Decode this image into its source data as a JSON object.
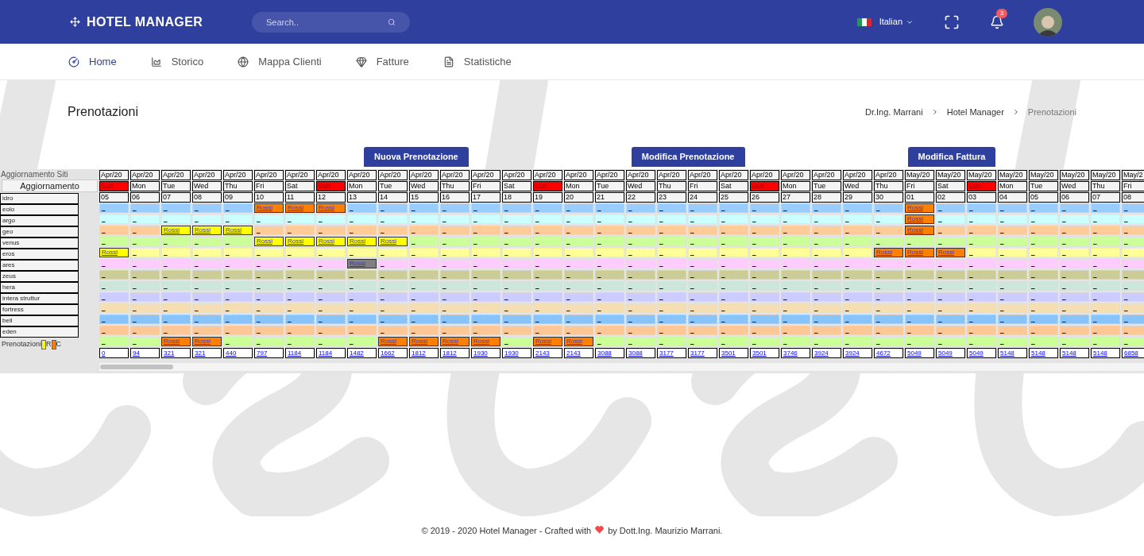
{
  "header": {
    "brand": "HOTEL MANAGER",
    "search": {
      "placeholder": "Search.."
    },
    "language": "Italian",
    "notifications": "3"
  },
  "nav": [
    {
      "label": "Home",
      "selected": true
    },
    {
      "label": "Storico",
      "selected": false
    },
    {
      "label": "Mappa Clienti",
      "selected": false
    },
    {
      "label": "Fatture",
      "selected": false
    },
    {
      "label": "Statistiche",
      "selected": false
    }
  ],
  "page_title": "Prenotazioni",
  "breadcrumb": [
    "Dr.Ing. Marrani",
    "Hotel Manager",
    "Prenotazioni"
  ],
  "actions": [
    "Nuova Prenotazione",
    "Modifica Prenotazione",
    "Modifica Fattura"
  ],
  "sidebar": {
    "title": "Aggiornamento Siti",
    "button": "Aggiornamento",
    "legend": {
      "label": "Prenotazioni",
      "items": [
        {
          "text": "R",
          "color": "#ffff00"
        },
        {
          "text": "C",
          "color": "#ff8000"
        }
      ]
    }
  },
  "columns": [
    {
      "month": "Apr/20",
      "weekday": "Sun",
      "day": "05",
      "holiday": true,
      "total": "0"
    },
    {
      "month": "Apr/20",
      "weekday": "Mon",
      "day": "06",
      "holiday": false,
      "total": "94"
    },
    {
      "month": "Apr/20",
      "weekday": "Tue",
      "day": "07",
      "holiday": false,
      "total": "321"
    },
    {
      "month": "Apr/20",
      "weekday": "Wed",
      "day": "08",
      "holiday": false,
      "total": "321"
    },
    {
      "month": "Apr/20",
      "weekday": "Thu",
      "day": "09",
      "holiday": false,
      "total": "440"
    },
    {
      "month": "Apr/20",
      "weekday": "Fri",
      "day": "10",
      "holiday": false,
      "total": "797"
    },
    {
      "month": "Apr/20",
      "weekday": "Sat",
      "day": "11",
      "holiday": false,
      "total": "1184"
    },
    {
      "month": "Apr/20",
      "weekday": "Sun",
      "day": "12",
      "holiday": true,
      "total": "1184"
    },
    {
      "month": "Apr/20",
      "weekday": "Mon",
      "day": "13",
      "holiday": false,
      "total": "1482"
    },
    {
      "month": "Apr/20",
      "weekday": "Tue",
      "day": "14",
      "holiday": false,
      "total": "1662"
    },
    {
      "month": "Apr/20",
      "weekday": "Wed",
      "day": "15",
      "holiday": false,
      "total": "1812"
    },
    {
      "month": "Apr/20",
      "weekday": "Thu",
      "day": "16",
      "holiday": false,
      "total": "1812"
    },
    {
      "month": "Apr/20",
      "weekday": "Fri",
      "day": "17",
      "holiday": false,
      "total": "1930"
    },
    {
      "month": "Apr/20",
      "weekday": "Sat",
      "day": "18",
      "holiday": false,
      "total": "1930"
    },
    {
      "month": "Apr/20",
      "weekday": "Sun",
      "day": "19",
      "holiday": true,
      "total": "2143"
    },
    {
      "month": "Apr/20",
      "weekday": "Mon",
      "day": "20",
      "holiday": false,
      "total": "2143"
    },
    {
      "month": "Apr/20",
      "weekday": "Tue",
      "day": "21",
      "holiday": false,
      "total": "3088"
    },
    {
      "month": "Apr/20",
      "weekday": "Wed",
      "day": "22",
      "holiday": false,
      "total": "3088"
    },
    {
      "month": "Apr/20",
      "weekday": "Thu",
      "day": "23",
      "holiday": false,
      "total": "3177"
    },
    {
      "month": "Apr/20",
      "weekday": "Fri",
      "day": "24",
      "holiday": false,
      "total": "3177"
    },
    {
      "month": "Apr/20",
      "weekday": "Sat",
      "day": "25",
      "holiday": false,
      "total": "3501"
    },
    {
      "month": "Apr/20",
      "weekday": "Sun",
      "day": "26",
      "holiday": true,
      "total": "3501"
    },
    {
      "month": "Apr/20",
      "weekday": "Mon",
      "day": "27",
      "holiday": false,
      "total": "3746"
    },
    {
      "month": "Apr/20",
      "weekday": "Tue",
      "day": "28",
      "holiday": false,
      "total": "3924"
    },
    {
      "month": "Apr/20",
      "weekday": "Wed",
      "day": "29",
      "holiday": false,
      "total": "3924"
    },
    {
      "month": "Apr/20",
      "weekday": "Thu",
      "day": "30",
      "holiday": false,
      "total": "4672"
    },
    {
      "month": "May/20",
      "weekday": "Fri",
      "day": "01",
      "holiday": false,
      "total": "5049"
    },
    {
      "month": "May/20",
      "weekday": "Sat",
      "day": "02",
      "holiday": false,
      "total": "5049"
    },
    {
      "month": "May/20",
      "weekday": "Sun",
      "day": "03",
      "holiday": true,
      "total": "5049"
    },
    {
      "month": "May/20",
      "weekday": "Mon",
      "day": "04",
      "holiday": false,
      "total": "5148"
    },
    {
      "month": "May/20",
      "weekday": "Tue",
      "day": "05",
      "holiday": false,
      "total": "5148"
    },
    {
      "month": "May/20",
      "weekday": "Wed",
      "day": "06",
      "holiday": false,
      "total": "5148"
    },
    {
      "month": "May/20",
      "weekday": "Thu",
      "day": "07",
      "holiday": false,
      "total": "5148"
    },
    {
      "month": "May/2",
      "weekday": "Fri",
      "day": "08",
      "holiday": false,
      "total": "6858"
    }
  ],
  "rooms": [
    {
      "name": "idro",
      "color": "#99ccff",
      "cells": [
        "_",
        "_",
        "_",
        "_",
        "_",
        {
          "text": "Rossi",
          "color": "#ff8000"
        },
        {
          "text": "Rossi",
          "color": "#ff8000"
        },
        {
          "text": "Rossi",
          "color": "#ff8000"
        },
        "_",
        "_",
        "_",
        "_",
        "_",
        "_",
        "_",
        "_",
        "_",
        "_",
        "_",
        "_",
        "_",
        "_",
        "_",
        "_",
        "_",
        "_",
        {
          "text": "Rossi",
          "color": "#ff8000"
        },
        "_",
        "_",
        "_",
        "_",
        "_",
        "_",
        "_"
      ]
    },
    {
      "name": "eolo",
      "color": "#ccffff",
      "cells": [
        "_",
        "_",
        "_",
        "_",
        "_",
        "_",
        "_",
        "_",
        "_",
        "_",
        "_",
        "_",
        "_",
        "_",
        "_",
        "_",
        "_",
        "_",
        "_",
        "_",
        "_",
        "_",
        "_",
        "_",
        "_",
        "_",
        {
          "text": "Rossi",
          "color": "#ff8000"
        },
        "_",
        "_",
        "_",
        "_",
        "_",
        "_",
        "_"
      ]
    },
    {
      "name": "argo",
      "color": "#ffcc99",
      "cells": [
        "_",
        "_",
        {
          "text": "Rossi",
          "color": "#ffff00"
        },
        {
          "text": "Rossi",
          "color": "#ffff00"
        },
        {
          "text": "Rossi",
          "color": "#ffff00"
        },
        "_",
        "_",
        "_",
        "_",
        "_",
        "_",
        "_",
        "_",
        "_",
        "_",
        "_",
        "_",
        "_",
        "_",
        "_",
        "_",
        "_",
        "_",
        "_",
        "_",
        "_",
        {
          "text": "Rossi",
          "color": "#ff8000"
        },
        "_",
        "_",
        "_",
        "_",
        "_",
        "_",
        "_"
      ]
    },
    {
      "name": "geo",
      "color": "#ccff99",
      "cells": [
        "_",
        "_",
        "_",
        "_",
        "_",
        {
          "text": "Rossi",
          "color": "#ffff00"
        },
        {
          "text": "Rossi",
          "color": "#ffff00"
        },
        {
          "text": "Rossi",
          "color": "#ffff00"
        },
        {
          "text": "Rossi",
          "color": "#ffff00"
        },
        {
          "text": "Rossi",
          "color": "#ffff00"
        },
        "_",
        "_",
        "_",
        "_",
        "_",
        "_",
        "_",
        "_",
        "_",
        "_",
        "_",
        "_",
        "_",
        "_",
        "_",
        "_",
        "_",
        "_",
        "_",
        "_",
        "_",
        "_",
        "_",
        "_"
      ]
    },
    {
      "name": "venus",
      "color": "#ffff99",
      "cells": [
        {
          "text": "Rossi",
          "color": "#ffff00"
        },
        "_",
        "_",
        "_",
        "_",
        "_",
        "_",
        "_",
        "_",
        "_",
        "_",
        "_",
        "_",
        "_",
        "_",
        "_",
        "_",
        "_",
        "_",
        "_",
        "_",
        "_",
        "_",
        "_",
        "_",
        {
          "text": "Rossi",
          "color": "#ff8000"
        },
        {
          "text": "Rossi",
          "color": "#ff8000"
        },
        {
          "text": "Rossi",
          "color": "#ff8000"
        },
        "_",
        "_",
        "_",
        "_",
        "_",
        "_"
      ]
    },
    {
      "name": "eros",
      "color": "#ffccff",
      "cells": [
        "_",
        "_",
        "_",
        "_",
        "_",
        "_",
        "_",
        "_",
        {
          "text": "Rossi",
          "color": "#808080"
        },
        "_",
        "_",
        "_",
        "_",
        "_",
        "_",
        "_",
        "_",
        "_",
        "_",
        "_",
        "_",
        "_",
        "_",
        "_",
        "_",
        "_",
        "_",
        "_",
        "_",
        "_",
        "_",
        "_",
        "_",
        "_"
      ]
    },
    {
      "name": "ares",
      "color": "#cccc99",
      "cells": [
        "_",
        "_",
        "_",
        "_",
        "_",
        "_",
        "_",
        "_",
        "_",
        "_",
        "_",
        "_",
        "_",
        "_",
        "_",
        "_",
        "_",
        "_",
        "_",
        "_",
        "_",
        "_",
        "_",
        "_",
        "_",
        "_",
        "_",
        "_",
        "_",
        "_",
        "_",
        "_",
        "_",
        "_"
      ]
    },
    {
      "name": "zeus",
      "color": "#cce6dc",
      "cells": [
        "_",
        "_",
        "_",
        "_",
        "_",
        "_",
        "_",
        "_",
        "_",
        "_",
        "_",
        "_",
        "_",
        "_",
        "_",
        "_",
        "_",
        "_",
        "_",
        "_",
        "_",
        "_",
        "_",
        "_",
        "_",
        "_",
        "_",
        "_",
        "_",
        "_",
        "_",
        "_",
        "_",
        "_"
      ]
    },
    {
      "name": "hera",
      "color": "#ccccff",
      "cells": [
        "_",
        "_",
        "_",
        "_",
        "_",
        "_",
        "_",
        "_",
        "_",
        "_",
        "_",
        "_",
        "_",
        "_",
        "_",
        "_",
        "_",
        "_",
        "_",
        "_",
        "_",
        "_",
        "_",
        "_",
        "_",
        "_",
        "_",
        "_",
        "_",
        "_",
        "_",
        "_",
        "_",
        "_"
      ]
    },
    {
      "name": "intera struttur",
      "color": "#f5deb3",
      "cells": [
        "_",
        "_",
        "_",
        "_",
        "_",
        "_",
        "_",
        "_",
        "_",
        "_",
        "_",
        "_",
        "_",
        "_",
        "_",
        "_",
        "_",
        "_",
        "_",
        "_",
        "_",
        "_",
        "_",
        "_",
        "_",
        "_",
        "_",
        "_",
        "_",
        "_",
        "_",
        "_",
        "_",
        "_"
      ]
    },
    {
      "name": "fortress",
      "color": "#88c4fa",
      "cells": [
        "_",
        "_",
        "_",
        "_",
        "_",
        "_",
        "_",
        "_",
        "_",
        "_",
        "_",
        "_",
        "_",
        "_",
        "_",
        "_",
        "_",
        "_",
        "_",
        "_",
        "_",
        "_",
        "_",
        "_",
        "_",
        "_",
        "_",
        "_",
        "_",
        "_",
        "_",
        "_",
        "_",
        "_"
      ]
    },
    {
      "name": "bell",
      "color": "#fec896",
      "cells": [
        "_",
        "_",
        "_",
        "_",
        "_",
        "_",
        "_",
        "_",
        "_",
        "_",
        "_",
        "_",
        "_",
        "_",
        "_",
        "_",
        "_",
        "_",
        "_",
        "_",
        "_",
        "_",
        "_",
        "_",
        "_",
        "_",
        "_",
        "_",
        "_",
        "_",
        "_",
        "_",
        "_",
        "_"
      ]
    },
    {
      "name": "eden",
      "color": "#ccff98",
      "cells": [
        "_",
        "_",
        {
          "text": "Rossi",
          "color": "#ff8000"
        },
        {
          "text": "Rossi",
          "color": "#ff8000"
        },
        "_",
        "_",
        "_",
        "_",
        "_",
        {
          "text": "Rossi",
          "color": "#ff8000"
        },
        {
          "text": "Rossi",
          "color": "#ff8000"
        },
        {
          "text": "Rossi",
          "color": "#ff8000"
        },
        {
          "text": "Rossi",
          "color": "#ff8000"
        },
        "_",
        {
          "text": "Rossi",
          "color": "#ff8000"
        },
        {
          "text": "Rossi",
          "color": "#ff8000"
        },
        "_",
        "_",
        "_",
        "_",
        "_",
        "_",
        "_",
        "_",
        "_",
        "_",
        "_",
        "_",
        "_",
        "_",
        "_",
        "_",
        "_",
        "_"
      ]
    }
  ],
  "footer": {
    "before": "© 2019 - 2020 Hotel Manager - Crafted with",
    "after": "by Dott.Ing. Maurizio Marrani."
  }
}
